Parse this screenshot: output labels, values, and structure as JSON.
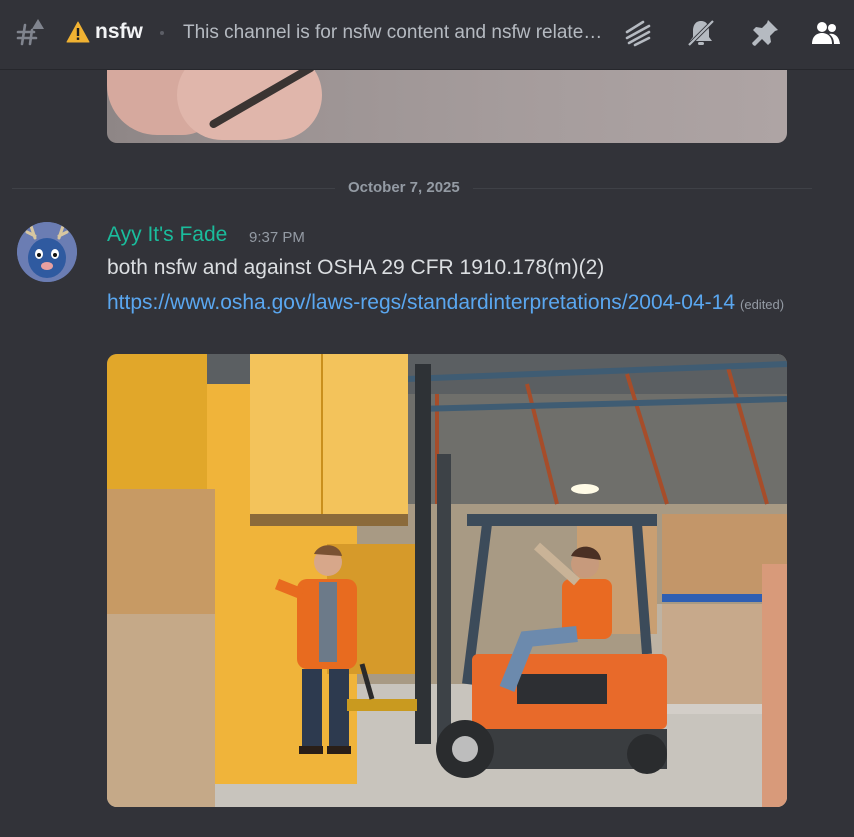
{
  "header": {
    "channel_name": "nsfw",
    "topic": "This channel is for nsfw content and nsfw related discussion",
    "icons": [
      "threads-icon",
      "notifications-muted-icon",
      "pin-icon",
      "member-list-icon"
    ]
  },
  "divider": {
    "date": "October 7, 2025"
  },
  "message": {
    "author": "Ayy It's Fade",
    "time": "9:37 PM",
    "text": "both nsfw and against OSHA  29 CFR 1910.178(m)(2)",
    "link": "https://www.osha.gov/laws-regs/standardinterpretations/2004-04-14",
    "edited": "(edited)"
  },
  "colors": {
    "background": "#323339",
    "author": "#1abc9c",
    "link": "#5aa7f0",
    "warning": "#f0b232"
  }
}
